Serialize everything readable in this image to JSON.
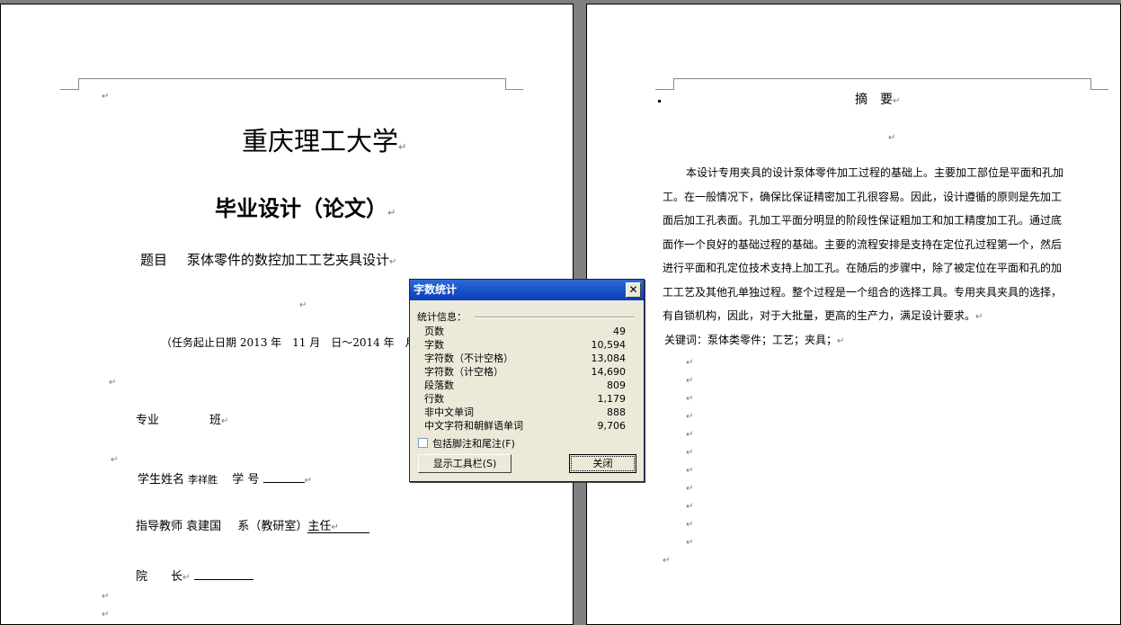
{
  "left_page": {
    "university": "重庆理工大学",
    "thesis_type": "毕业设计（论文）",
    "topic_label": "题目",
    "topic_value": "泵体零件的数控加工工艺夹具设计",
    "task_period": "（任务起止日期 2013 年　11 月　日～2014 年　月",
    "major_label": "专业",
    "class_label": "班",
    "student_label": "学生姓名",
    "student_name": "李祥胜",
    "student_no_label": "学 号",
    "advisor_label": "指导教师",
    "advisor_name": "袁建国",
    "dept_label": "系（教研室）",
    "dept_role": "主任",
    "dean_label": "院　　长"
  },
  "right_page": {
    "abstract_title": "摘　要",
    "abstract_lines": [
      "本设计专用夹具的设计泵体零件加工过程的基础上。主要加工部位是平面和孔加",
      "工。在一般情况下，确保比保证精密加工孔很容易。因此，设计遵循的原则是先加工",
      "面后加工孔表面。孔加工平面分明显的阶段性保证粗加工和加工精度加工孔。通过底",
      "面作一个良好的基础过程的基础。主要的流程安排是支持在定位孔过程第一个，然后",
      "进行平面和孔定位技术支持上加工孔。在随后的步骤中，除了被定位在平面和孔的加",
      "工工艺及其他孔单独过程。整个过程是一个组合的选择工具。专用夹具夹具的选择，",
      "有自锁机构，因此，对于大批量，更高的生产力，满足设计要求。"
    ],
    "keywords": "关键词：泵体类零件；工艺；夹具；"
  },
  "dialog": {
    "title": "字数统计",
    "group_label": "统计信息：",
    "stats": [
      {
        "label": "页数",
        "value": "49"
      },
      {
        "label": "字数",
        "value": "10,594"
      },
      {
        "label": "字符数（不计空格）",
        "value": "13,084"
      },
      {
        "label": "字符数（计空格）",
        "value": "14,690"
      },
      {
        "label": "段落数",
        "value": "809"
      },
      {
        "label": "行数",
        "value": "1,179"
      },
      {
        "label": "非中文单词",
        "value": "888"
      },
      {
        "label": "中文字符和朝鲜语单词",
        "value": "9,706"
      }
    ],
    "include_footnotes_label": "包括脚注和尾注(F)",
    "include_footnotes_checked": false,
    "show_toolbar_label": "显示工具栏(S)",
    "close_label": "关闭",
    "close_icon": "✕"
  },
  "paragraph_mark": "↵"
}
